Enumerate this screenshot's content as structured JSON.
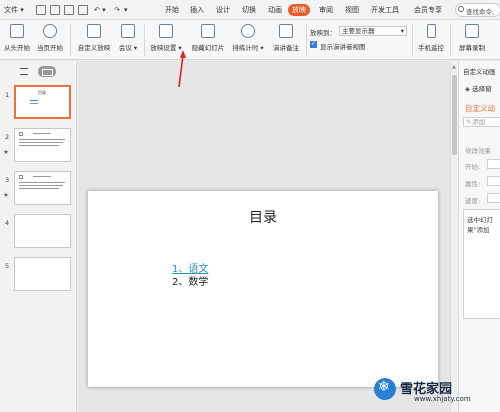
{
  "menubar": {
    "file": "文件",
    "tabs": [
      "开始",
      "插入",
      "设计",
      "切换",
      "动画",
      "放映",
      "审阅",
      "视图",
      "开发工具",
      "会员专享"
    ],
    "active_tab": "放映",
    "search_placeholder": "查找命令、"
  },
  "ribbon": {
    "from_start": "从头开始",
    "from_current": "当页开始",
    "custom_show": "自定义放映",
    "meeting": "会议",
    "show_settings": "放映设置",
    "hide_slide": "隐藏幻灯片",
    "rehearse_timing": "排练计时",
    "speaker_notes": "演讲备注",
    "show_on_label": "放映到：",
    "show_on_value": "主要显示器",
    "presenter_view": "显示演讲者视图",
    "phone_remote": "手机遥控",
    "screen_record": "屏幕录制"
  },
  "thumbnails": [
    {
      "num": "1",
      "title": "目录",
      "selected": true,
      "star": ""
    },
    {
      "num": "2",
      "title": "",
      "selected": false,
      "star": "★"
    },
    {
      "num": "3",
      "title": "",
      "selected": false,
      "star": "★"
    },
    {
      "num": "4",
      "title": "",
      "selected": false,
      "star": ""
    },
    {
      "num": "5",
      "title": "",
      "selected": false,
      "star": ""
    }
  ],
  "slide": {
    "title": "目录",
    "item1": "1、语文",
    "item2": "2、数学"
  },
  "right_panel": {
    "header": "自定义动画",
    "select_pane": "选择窗",
    "custom_anim": "自定义动",
    "add_effect": "添加",
    "modify_effect": "修改效果",
    "start_label": "开始:",
    "property_label": "属性:",
    "speed_label": "速度:",
    "hint_line1": "选中幻灯",
    "hint_line2": "果\"添加"
  },
  "watermark": {
    "main": "雪花家园",
    "sub": "www.xhjaty.com"
  },
  "colors": {
    "accent": "#e85c2b",
    "link": "#2d8fb3",
    "selection_border": "#e8743b"
  }
}
